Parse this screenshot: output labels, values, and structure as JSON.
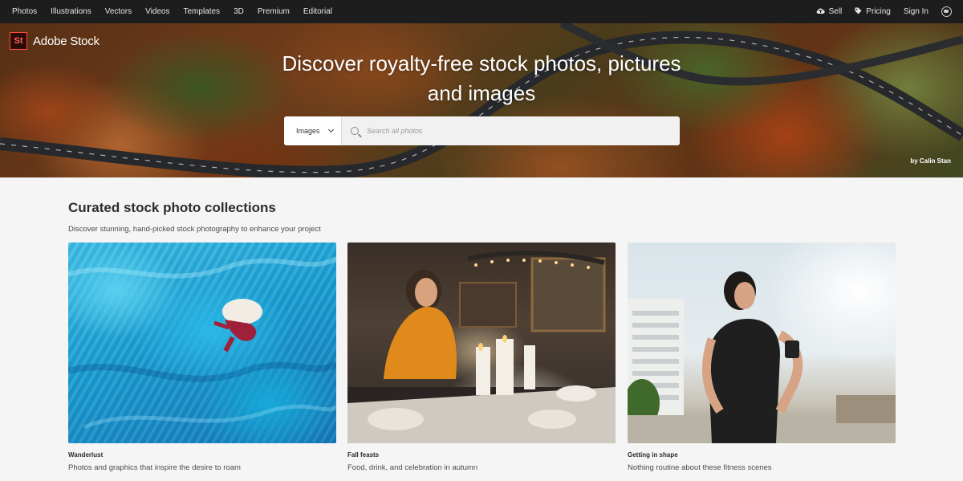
{
  "topnav": {
    "left_items": [
      {
        "label": "Photos"
      },
      {
        "label": "Illustrations"
      },
      {
        "label": "Vectors"
      },
      {
        "label": "Videos"
      },
      {
        "label": "Templates"
      },
      {
        "label": "3D"
      },
      {
        "label": "Premium"
      },
      {
        "label": "Editorial"
      }
    ],
    "sell_label": "Sell",
    "pricing_label": "Pricing",
    "signin_label": "Sign In"
  },
  "hero": {
    "logo_mark": "St",
    "logo_text": "Adobe Stock",
    "title_line1": "Discover royalty-free stock photos, pictures",
    "title_line2": "and images",
    "search": {
      "type_value": "Images",
      "placeholder": "Search all photos"
    },
    "credit": "by Calin Stan"
  },
  "section": {
    "title": "Curated stock photo collections",
    "subtitle": "Discover stunning, hand-picked stock photography to enhance your project",
    "cards": [
      {
        "title": "Wanderlust",
        "description": "Photos and graphics that inspire the desire to roam"
      },
      {
        "title": "Fall feasts",
        "description": "Food, drink, and celebration in autumn"
      },
      {
        "title": "Getting in shape",
        "description": "Nothing routine about these fitness scenes"
      }
    ]
  },
  "colors": {
    "nav_bg": "#1d1d1d",
    "page_bg": "#f5f5f5",
    "logo_accent": "#ff4c3c"
  }
}
